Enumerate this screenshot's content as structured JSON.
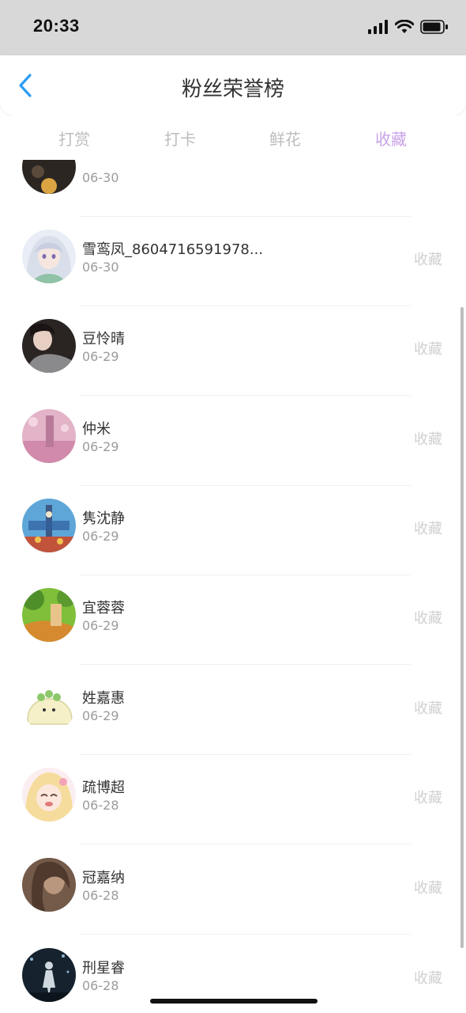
{
  "status": {
    "time": "20:33"
  },
  "header": {
    "title": "粉丝荣誉榜"
  },
  "tabs": [
    {
      "label": "打赏",
      "active": false
    },
    {
      "label": "打卡",
      "active": false
    },
    {
      "label": "鲜花",
      "active": false
    },
    {
      "label": "收藏",
      "active": true
    }
  ],
  "colors": {
    "active_tab": "#c9a3e6",
    "back_arrow": "#2a9df4"
  },
  "list": {
    "partial": {
      "date": "06-30"
    },
    "items": [
      {
        "name": "雪鸾凤_8604716591978...",
        "date": "06-30",
        "action": "收藏",
        "avatar": "anime-girl-avatar"
      },
      {
        "name": "豆怜晴",
        "date": "06-29",
        "action": "收藏",
        "avatar": "woman-photo-avatar"
      },
      {
        "name": "仲米",
        "date": "06-29",
        "action": "收藏",
        "avatar": "pink-scene-avatar"
      },
      {
        "name": "隽沈静",
        "date": "06-29",
        "action": "收藏",
        "avatar": "clock-tower-avatar"
      },
      {
        "name": "宜蓉蓉",
        "date": "06-29",
        "action": "收藏",
        "avatar": "green-landscape-avatar"
      },
      {
        "name": "姓嘉惠",
        "date": "06-29",
        "action": "收藏",
        "avatar": "cartoon-chick-avatar"
      },
      {
        "name": "疏博超",
        "date": "06-28",
        "action": "收藏",
        "avatar": "anime-blonde-avatar"
      },
      {
        "name": "冠嘉纳",
        "date": "06-28",
        "action": "收藏",
        "avatar": "brown-portrait-avatar"
      },
      {
        "name": "刑星睿",
        "date": "06-28",
        "action": "收藏",
        "avatar": "dark-night-avatar"
      }
    ]
  }
}
